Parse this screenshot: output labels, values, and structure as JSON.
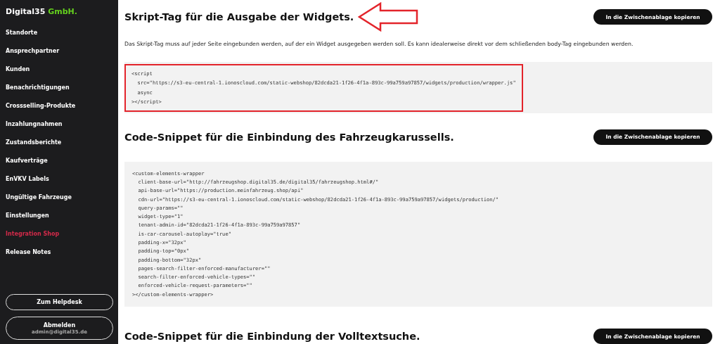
{
  "sidebar": {
    "logo": {
      "name": "Digital35",
      "suffix": "GmbH."
    },
    "items": [
      {
        "label": "Standorte",
        "selected": false
      },
      {
        "label": "Ansprechpartner",
        "selected": false
      },
      {
        "label": "Kunden",
        "selected": false
      },
      {
        "label": "Benachrichtigungen",
        "selected": false
      },
      {
        "label": "Crossselling-Produkte",
        "selected": false
      },
      {
        "label": "Inzahlungnahmen",
        "selected": false
      },
      {
        "label": "Zustandsberichte",
        "selected": false
      },
      {
        "label": "Kaufverträge",
        "selected": false
      },
      {
        "label": "EnVKV Labels",
        "selected": false
      },
      {
        "label": "Ungültige Fahrzeuge",
        "selected": false
      },
      {
        "label": "Einstellungen",
        "selected": false
      },
      {
        "label": "Integration Shop",
        "selected": true
      },
      {
        "label": "Release Notes",
        "selected": false
      }
    ],
    "helpdesk_button": "Zum Helpdesk",
    "logout_button": {
      "label": "Abmelden",
      "user": "admin@digital35.de"
    }
  },
  "sections": [
    {
      "title": "Skript-Tag für die Ausgabe der Widgets.",
      "arrow": true,
      "copy_button": "In die Zwischenablage kopieren",
      "description": "Das Skript-Tag muss auf jeder Seite eingebunden werden, auf der ein Widget ausgegeben werden soll. Es kann idealerweise direkt vor dem schließenden body-Tag eingebunden werden.",
      "highlighted": true,
      "code": [
        "<script",
        "  src=\"https://s3-eu-central-1.ionoscloud.com/static-webshop/82dcda21-1f26-4f1a-893c-99a759a97857/widgets/production/wrapper.js\"",
        "  async",
        "></script>"
      ]
    },
    {
      "title": "Code-Snippet für die Einbindung des Fahrzeugkarussells.",
      "copy_button": "In die Zwischenablage kopieren",
      "code": [
        "<custom-elements-wrapper",
        "  client-base-url=\"http://fahrzeugshop.digital35.de/digital35/fahrzeugshop.html#/\"",
        "  api-base-url=\"https://production.meinfahrzeug.shop/api\"",
        "  cdn-url=\"https://s3-eu-central-1.ionoscloud.com/static-webshop/82dcda21-1f26-4f1a-893c-99a759a97857/widgets/production/\"",
        "  query-params=\"\"",
        "  widget-type=\"1\"",
        "  tenant-admin-id=\"82dcda21-1f26-4f1a-893c-99a759a97857\"",
        "  is-car-carousel-autoplay=\"true\"",
        "  padding-x=\"32px\"",
        "  padding-top=\"0px\"",
        "  padding-bottom=\"32px\"",
        "  pages-search-filter-enforced-manufacturer=\"\"",
        "  search-filter-enforced-vehicle-types=\"\"",
        "  enforced-vehicle-request-parameters=\"\"",
        "></custom-elements-wrapper>"
      ]
    },
    {
      "title": "Code-Snippet für die Einbindung der Volltextsuche.",
      "copy_button": "In die Zwischenablage kopieren"
    }
  ]
}
